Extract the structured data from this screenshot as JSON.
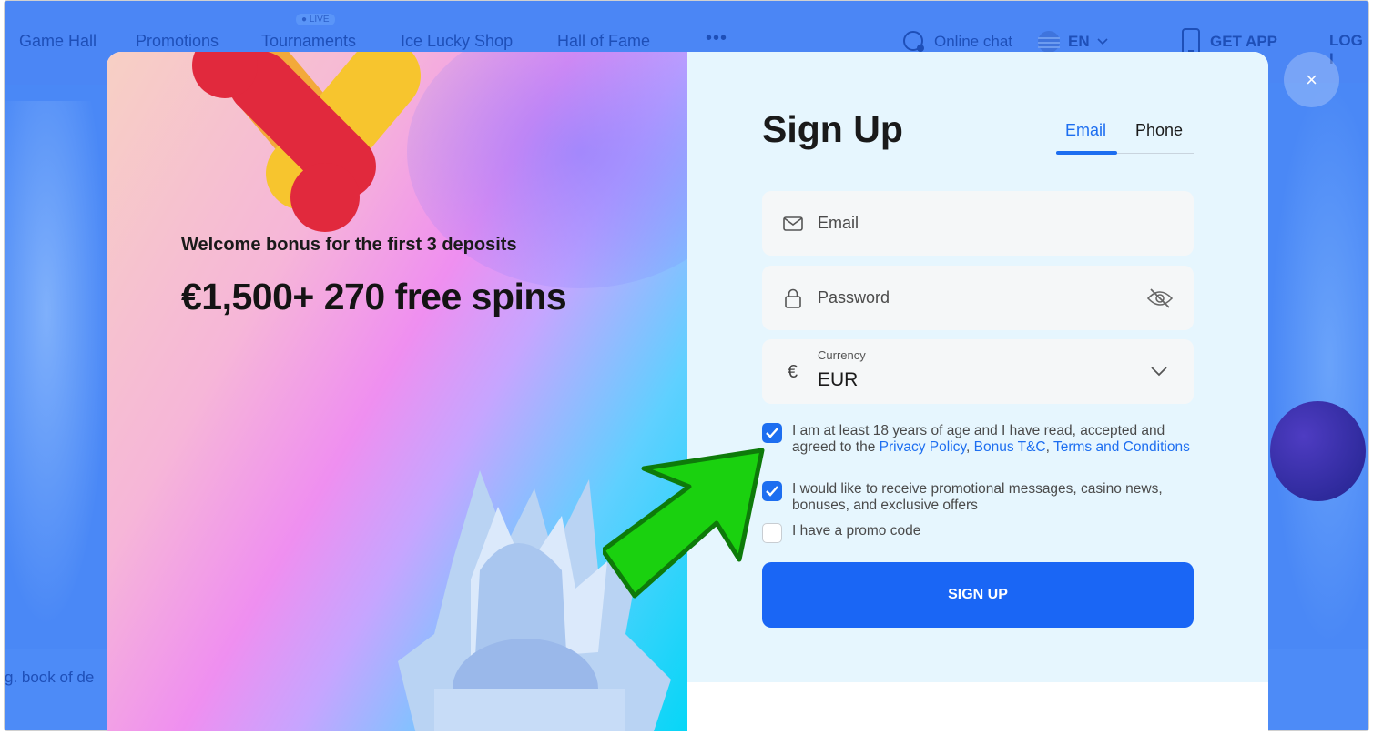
{
  "nav": {
    "items": [
      "Game Hall",
      "Promotions",
      "Tournaments",
      "Ice Lucky Shop",
      "Hall of Fame"
    ],
    "live_badge": "● LIVE",
    "more": "•••",
    "online_chat": "Online chat",
    "language": "EN",
    "get_app": "GET APP",
    "login": "LOG I"
  },
  "background": {
    "search_hint": "g. book of de"
  },
  "promo": {
    "subtitle": "Welcome bonus for the first 3 deposits",
    "headline": "€1,500+ 270 free spins"
  },
  "form": {
    "title": "Sign Up",
    "tabs": [
      {
        "label": "Email",
        "active": true
      },
      {
        "label": "Phone",
        "active": false
      }
    ],
    "email_placeholder": "Email",
    "password_placeholder": "Password",
    "currency_label": "Currency",
    "currency_symbol": "€",
    "currency_value": "EUR",
    "consent_age": {
      "checked": true,
      "text_start": "I am at least 18 years of age and I have read, accepted and agreed to the ",
      "link_privacy": "Privacy Policy",
      "sep1": ", ",
      "link_bonus": "Bonus T&C",
      "sep2": ", ",
      "link_terms": "Terms and Conditions"
    },
    "consent_promo": {
      "checked": true,
      "text": "I would like to receive promotional messages, casino news, bonuses, and exclusive offers"
    },
    "promo_code": {
      "checked": false,
      "text": "I have a promo code"
    },
    "submit_label": "SIGN UP"
  },
  "close_label": "×",
  "colors": {
    "accent": "#1d6ef0",
    "button": "#1a66f5",
    "form_bg": "#e6f6fe",
    "page_bg": "#4d8bf7",
    "arrow": "#16c60f"
  }
}
